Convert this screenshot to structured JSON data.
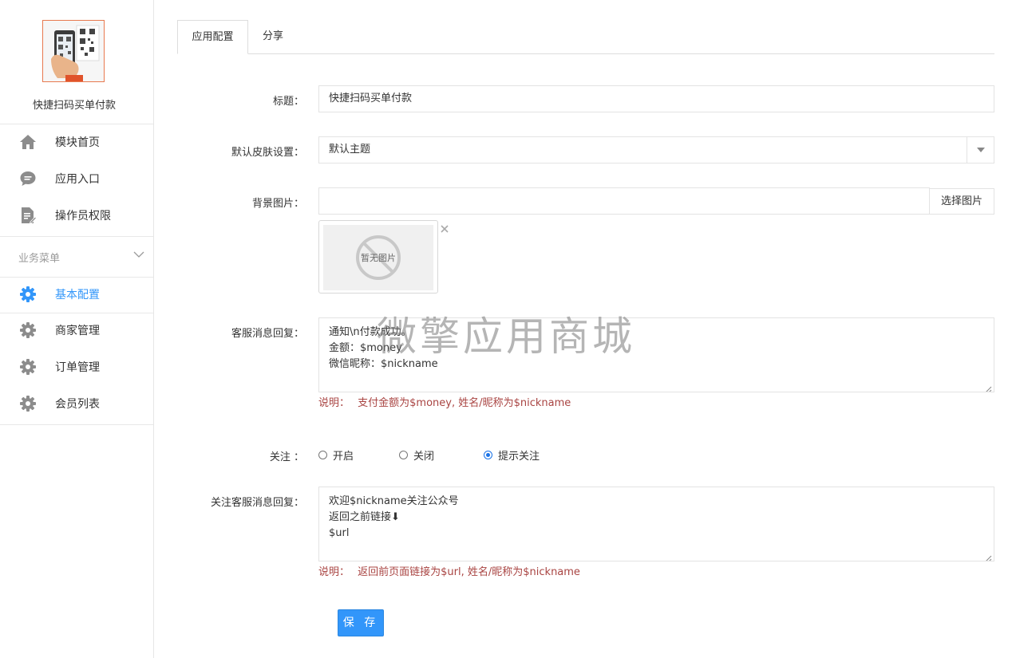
{
  "app": {
    "name": "快捷扫码买单付款"
  },
  "sidebar": {
    "top_items": [
      {
        "label": "模块首页",
        "icon": "home-icon"
      },
      {
        "label": "应用入口",
        "icon": "chat-bubble-icon"
      },
      {
        "label": "操作员权限",
        "icon": "document-edit-icon"
      }
    ],
    "group": {
      "title": "业务菜单"
    },
    "group_items": [
      {
        "label": "基本配置",
        "icon": "gear-icon",
        "active": true
      },
      {
        "label": "商家管理",
        "icon": "gear-icon"
      },
      {
        "label": "订单管理",
        "icon": "gear-icon"
      },
      {
        "label": "会员列表",
        "icon": "gear-icon"
      }
    ]
  },
  "tabs": [
    {
      "label": "应用配置",
      "active": true
    },
    {
      "label": "分享"
    }
  ],
  "form": {
    "title": {
      "label": "标题：",
      "value": "快捷扫码买单付款"
    },
    "skin": {
      "label": "默认皮肤设置：",
      "value": "默认主题"
    },
    "bg_image": {
      "label": "背景图片：",
      "button": "选择图片",
      "placeholder_text": "暂无图片"
    },
    "reply": {
      "label": "客服消息回复：",
      "lines": [
        "通知\\n付款成功。",
        "金额：$money",
        "微信昵称：$nickname"
      ],
      "hint_prefix": "说明：",
      "hint": "支付金额为$money, 姓名/昵称为$nickname"
    },
    "follow": {
      "label": "关注 ：",
      "options": [
        {
          "label": "开启",
          "checked": false
        },
        {
          "label": "关闭",
          "checked": false
        },
        {
          "label": "提示关注",
          "checked": true
        }
      ]
    },
    "follow_reply": {
      "label": "关注客服消息回复：",
      "lines": [
        "欢迎$nickname关注公众号",
        "返回之前链接⬇",
        "$url"
      ],
      "hint_prefix": "说明：",
      "hint": "返回前页面链接为$url, 姓名/昵称为$nickname"
    },
    "save": "保 存"
  },
  "watermark": "微擎应用商城",
  "colors": {
    "accent": "#3296fa",
    "hint": "#a94442",
    "border": "#e3e3e3"
  }
}
